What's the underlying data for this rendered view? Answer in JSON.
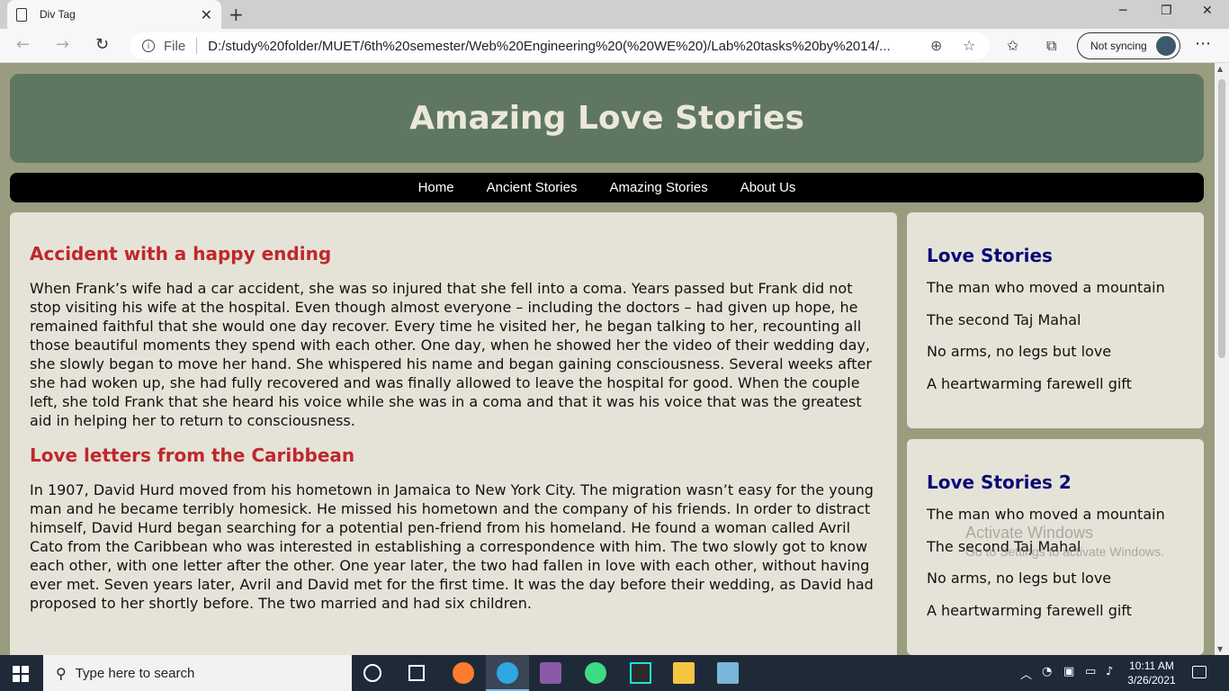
{
  "browser": {
    "tab_title": "Div Tag",
    "tab_close": "✕",
    "new_tab": "+",
    "window_controls": {
      "minimize": "─",
      "restore": "❐",
      "close": "✕"
    },
    "file_label": "File",
    "url": "D:/study%20folder/MUET/6th%20semester/Web%20Engineering%20(%20WE%20)/Lab%20tasks%20by%2014/...",
    "sync_label": "Not syncing",
    "icons": [
      "back-icon",
      "forward-icon",
      "refresh-icon",
      "info-icon",
      "zoom-icon",
      "favorite-star-icon",
      "favorites-icon",
      "collections-icon",
      "more-icon"
    ]
  },
  "page": {
    "header_title": "Amazing Love Stories",
    "nav": [
      "Home",
      "Ancient Stories",
      "Amazing Stories",
      "About Us"
    ],
    "stories": [
      {
        "title": "Accident with a happy ending",
        "body": "When Frank’s wife had a car accident, she was so injured that she fell into a coma. Years passed but Frank did not stop visiting his wife at the hospital. Even though almost everyone – including the doctors – had given up hope, he remained faithful that she would one day recover. Every time he visited her, he began talking to her, recounting all those beautiful moments they spend with each other. One day, when he showed her the video of their wedding day, she slowly began to move her hand. She whispered his name and began gaining consciousness. Several weeks after she had woken up, she had fully recovered and was finally allowed to leave the hospital for good. When the couple left, she told Frank that she heard his voice while she was in a coma and that it was his voice that was the greatest aid in helping her to return to consciousness."
      },
      {
        "title": "Love letters from the Caribbean",
        "body": "In 1907, David Hurd moved from his hometown in Jamaica to New York City. The migration wasn’t easy for the young man and he became terribly homesick. He missed his hometown and the company of his friends. In order to distract himself, David Hurd began searching for a potential pen-friend from his homeland. He found a woman called Avril Cato from the Caribbean who was interested in establishing a correspondence with him. The two slowly got to know each other, with one letter after the other. One year later, the two had fallen in love with each other, without having ever met. Seven years later, Avril and David met for the first time. It was the day before their wedding, as David had proposed to her shortly before. The two married and had six children."
      }
    ],
    "sidebar": [
      {
        "title": "Love Stories",
        "items": [
          "The man who moved a mountain",
          "The second Taj Mahal",
          "No arms, no legs but love",
          "A heartwarming farewell gift"
        ]
      },
      {
        "title": "Love Stories 2",
        "items": [
          "The man who moved a mountain",
          "The second Taj Mahal",
          "No arms, no legs but love",
          "A heartwarming farewell gift"
        ]
      }
    ],
    "colors": {
      "background": "#9a9c80",
      "header": "#5f7761",
      "nav": "#000000",
      "content": "#e5e3d7",
      "story_title": "#c0272d",
      "side_title": "#0a0a78"
    }
  },
  "watermark": {
    "line1": "Activate Windows",
    "line2": "Go to Settings to activate Windows."
  },
  "taskbar": {
    "search_placeholder": "Type here to search",
    "time": "10:11 AM",
    "date": "3/26/2021"
  }
}
